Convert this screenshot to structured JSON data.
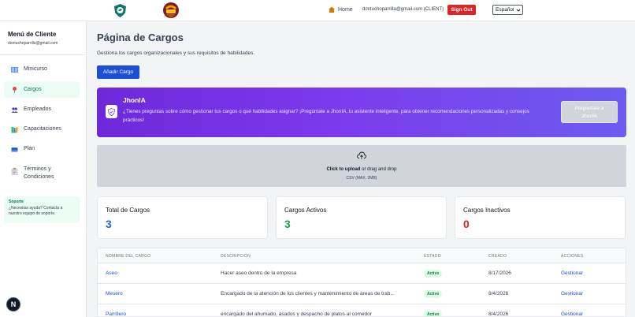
{
  "topbar": {
    "home_label": "Home",
    "user_email": "dontuchoparrilla@gmail.com (CLIENT)",
    "signout_label": "Sign Out",
    "language": "Español"
  },
  "sidebar": {
    "title": "Menú de Cliente",
    "email": "dontuchoparrilla@gmail.com",
    "items": [
      {
        "label": "Minicurso",
        "icon": "book-icon"
      },
      {
        "label": "Cargos",
        "icon": "pin-icon",
        "active": true
      },
      {
        "label": "Empleados",
        "icon": "people-icon"
      },
      {
        "label": "Capacitaciones",
        "icon": "books-icon"
      },
      {
        "label": "Plan",
        "icon": "card-icon"
      },
      {
        "label_line1": "Términos y",
        "label_line2": "Condiciones",
        "icon": "clipboard-icon"
      }
    ],
    "support": {
      "title": "Soporte",
      "desc_line1": "¿Necesitas ayuda? Contacta a",
      "desc_line2": "nuestro equipo de soporte."
    }
  },
  "main": {
    "title": "Página de Cargos",
    "subtitle": "Gestiona los cargos organizacionales y sus requisitos de habilidades.",
    "add_label": "Añadir Cargo",
    "ai": {
      "title": "JhonIA",
      "desc": "¿Tienes preguntas sobre cómo gestionar tus cargos o qué habilidades asignar? ¡Pregúntale a JhonIA, tu asistente inteligente, para obtener recomendaciones personalizadas y consejos prácticos!",
      "button_line1": "Pregúntale a",
      "button_line2": "JhonIA"
    },
    "upload": {
      "click_label": "Click to upload",
      "rest_label": " or drag and drop",
      "format": "CSV (MAX. 2MB)"
    },
    "stats": [
      {
        "label": "Total de Cargos",
        "value": "3",
        "color": "#2563eb"
      },
      {
        "label": "Cargos Activos",
        "value": "3",
        "color": "#16a34a"
      },
      {
        "label": "Cargos Inactivos",
        "value": "0",
        "color": "#dc2626"
      }
    ],
    "table": {
      "headers": [
        "NOMBRE DEL CARGO",
        "DESCRIPCIÓN",
        "ESTADO",
        "CREADO",
        "ACCIONES"
      ],
      "rows": [
        {
          "name": "Aseo",
          "desc": "Hacer aseo dentro de la empresa",
          "status": "Activo",
          "created": "8/17/2026",
          "action": "Gestionar"
        },
        {
          "name": "Mesero",
          "desc": "Encargado de la atención de los clientes y mantenimiento de areas de trab...",
          "status": "Activo",
          "created": "8/4/2026",
          "action": "Gestionar"
        },
        {
          "name": "Parrillero",
          "desc": "encargado del ahumado, asados y despacho de platos al comedor",
          "status": "Activo",
          "created": "8/4/2026",
          "action": "Gestionar"
        }
      ]
    }
  },
  "floating": {
    "label": "N"
  }
}
